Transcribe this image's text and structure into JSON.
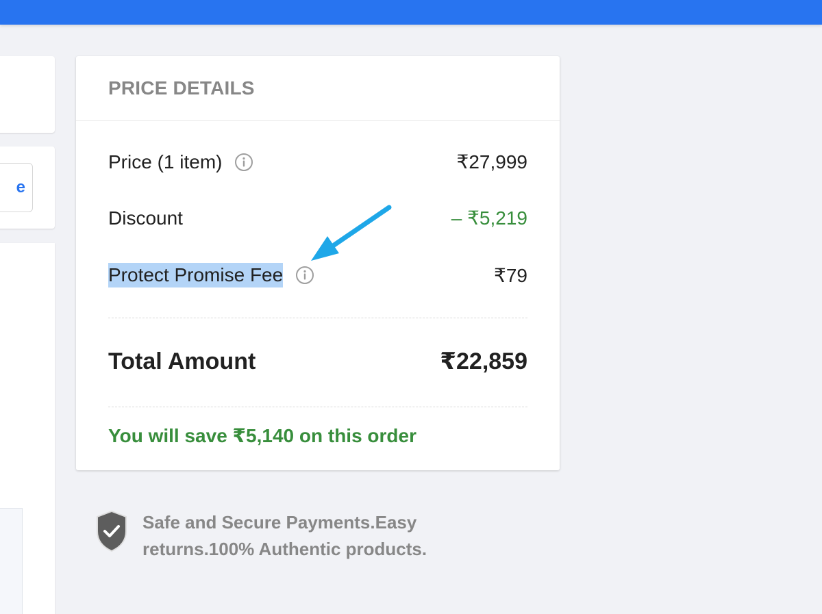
{
  "left": {
    "button_fragment": "e"
  },
  "price_details": {
    "title": "PRICE DETAILS",
    "rows": [
      {
        "label": "Price (1 item)",
        "value": "₹27,999",
        "has_info_icon": true
      },
      {
        "label": "Discount",
        "value": "– ₹5,219",
        "value_color": "#388e3c",
        "has_info_icon": false
      },
      {
        "label": "Protect Promise Fee",
        "value": "₹79",
        "has_info_icon": true,
        "highlighted": true
      }
    ],
    "total": {
      "label": "Total Amount",
      "value": "₹22,859"
    },
    "savings": "You will save ₹5,140 on this order"
  },
  "secure_note": {
    "line1": "Safe and Secure Payments.Easy",
    "line2": "returns.100% Authentic products.",
    "icon": "shield-check-icon"
  },
  "colors": {
    "brand_blue": "#2874f0",
    "green": "#388e3c",
    "highlight": "#b3d4f7",
    "annotation_arrow": "#1ea7e8"
  }
}
